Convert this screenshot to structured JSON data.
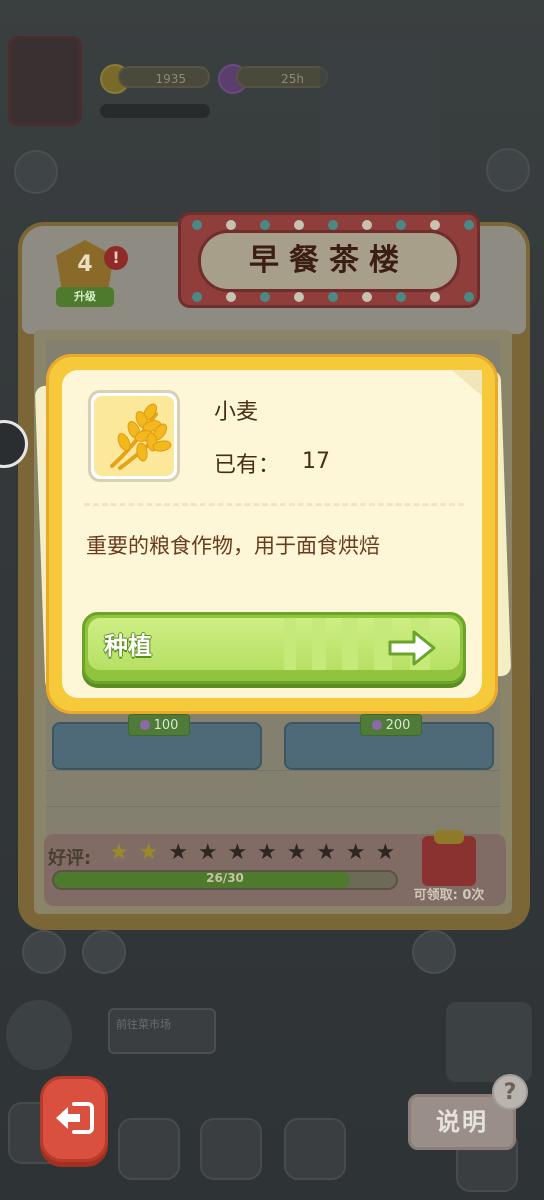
{
  "hud": {
    "coins": "1935",
    "gems": "25h"
  },
  "shop": {
    "sign_title": "早餐茶楼",
    "level": "4",
    "alert": "!",
    "upgrade_label": "升级",
    "stalls": [
      {
        "price": "100"
      },
      {
        "price": "200"
      }
    ],
    "rating": {
      "label": "好评:",
      "stars_total": 10,
      "stars_filled": 2,
      "progress_text": "26/30",
      "progress_value": 26,
      "progress_max": 30,
      "claim_text": "可领取: 0次"
    }
  },
  "popup": {
    "item_name": "小麦",
    "owned_label": "已有：",
    "owned_value": "17",
    "description": "重要的粮食作物，用于面食烘焙",
    "action_label": "种植",
    "item_icon": "wheat-icon"
  },
  "bottom": {
    "explain_label": "说明",
    "help_glyph": "?",
    "task_hint": "前往菜市场"
  },
  "colors": {
    "popup_border": "#f6c93a",
    "popup_bg": "#fdf7d8",
    "button_green": "#8fc43c",
    "text_brown": "#4a2e12",
    "back_red": "#d9503e"
  }
}
